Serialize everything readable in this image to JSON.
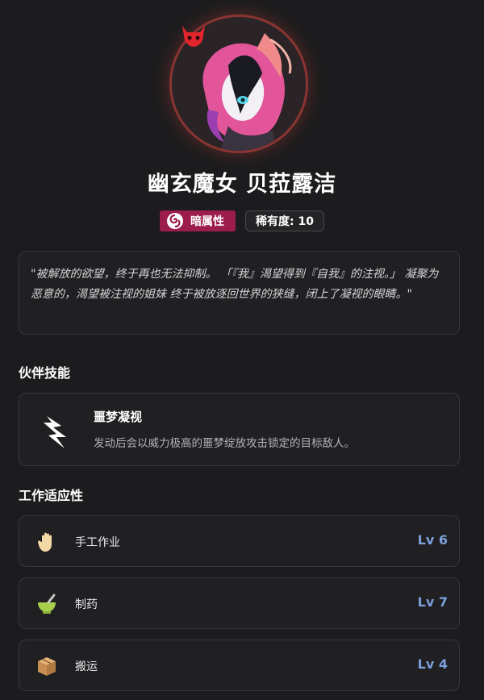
{
  "character": {
    "name": "幽玄魔女 贝菈露洁",
    "element": "暗属性",
    "rarity": "稀有度: 10",
    "description": "\"被解放的欲望，终于再也无法抑制。 「『我』渴望得到『自我』的注视。」 凝聚为恶意的，渴望被注视的姐妹 终于被放逐回世界的狭缝，闭上了凝视的眼睛。\""
  },
  "sections": {
    "skill_title": "伙伴技能",
    "work_title": "工作适应性"
  },
  "skill": {
    "name": "噩梦凝视",
    "description": "发动后会以威力极高的噩梦绽放攻击锁定的目标敌人。",
    "icon": "claw-slash-icon"
  },
  "work": [
    {
      "label": "手工作业",
      "level": "Lv 6",
      "icon": "hand-icon"
    },
    {
      "label": "制药",
      "level": "Lv 7",
      "icon": "mortar-icon"
    },
    {
      "label": "搬运",
      "level": "Lv 4",
      "icon": "box-icon"
    }
  ],
  "colors": {
    "background": "#1c1c1e",
    "element_badge": "#9c1d4c",
    "level": "#7d9fdc",
    "avatar_ring": "#8a3532"
  }
}
